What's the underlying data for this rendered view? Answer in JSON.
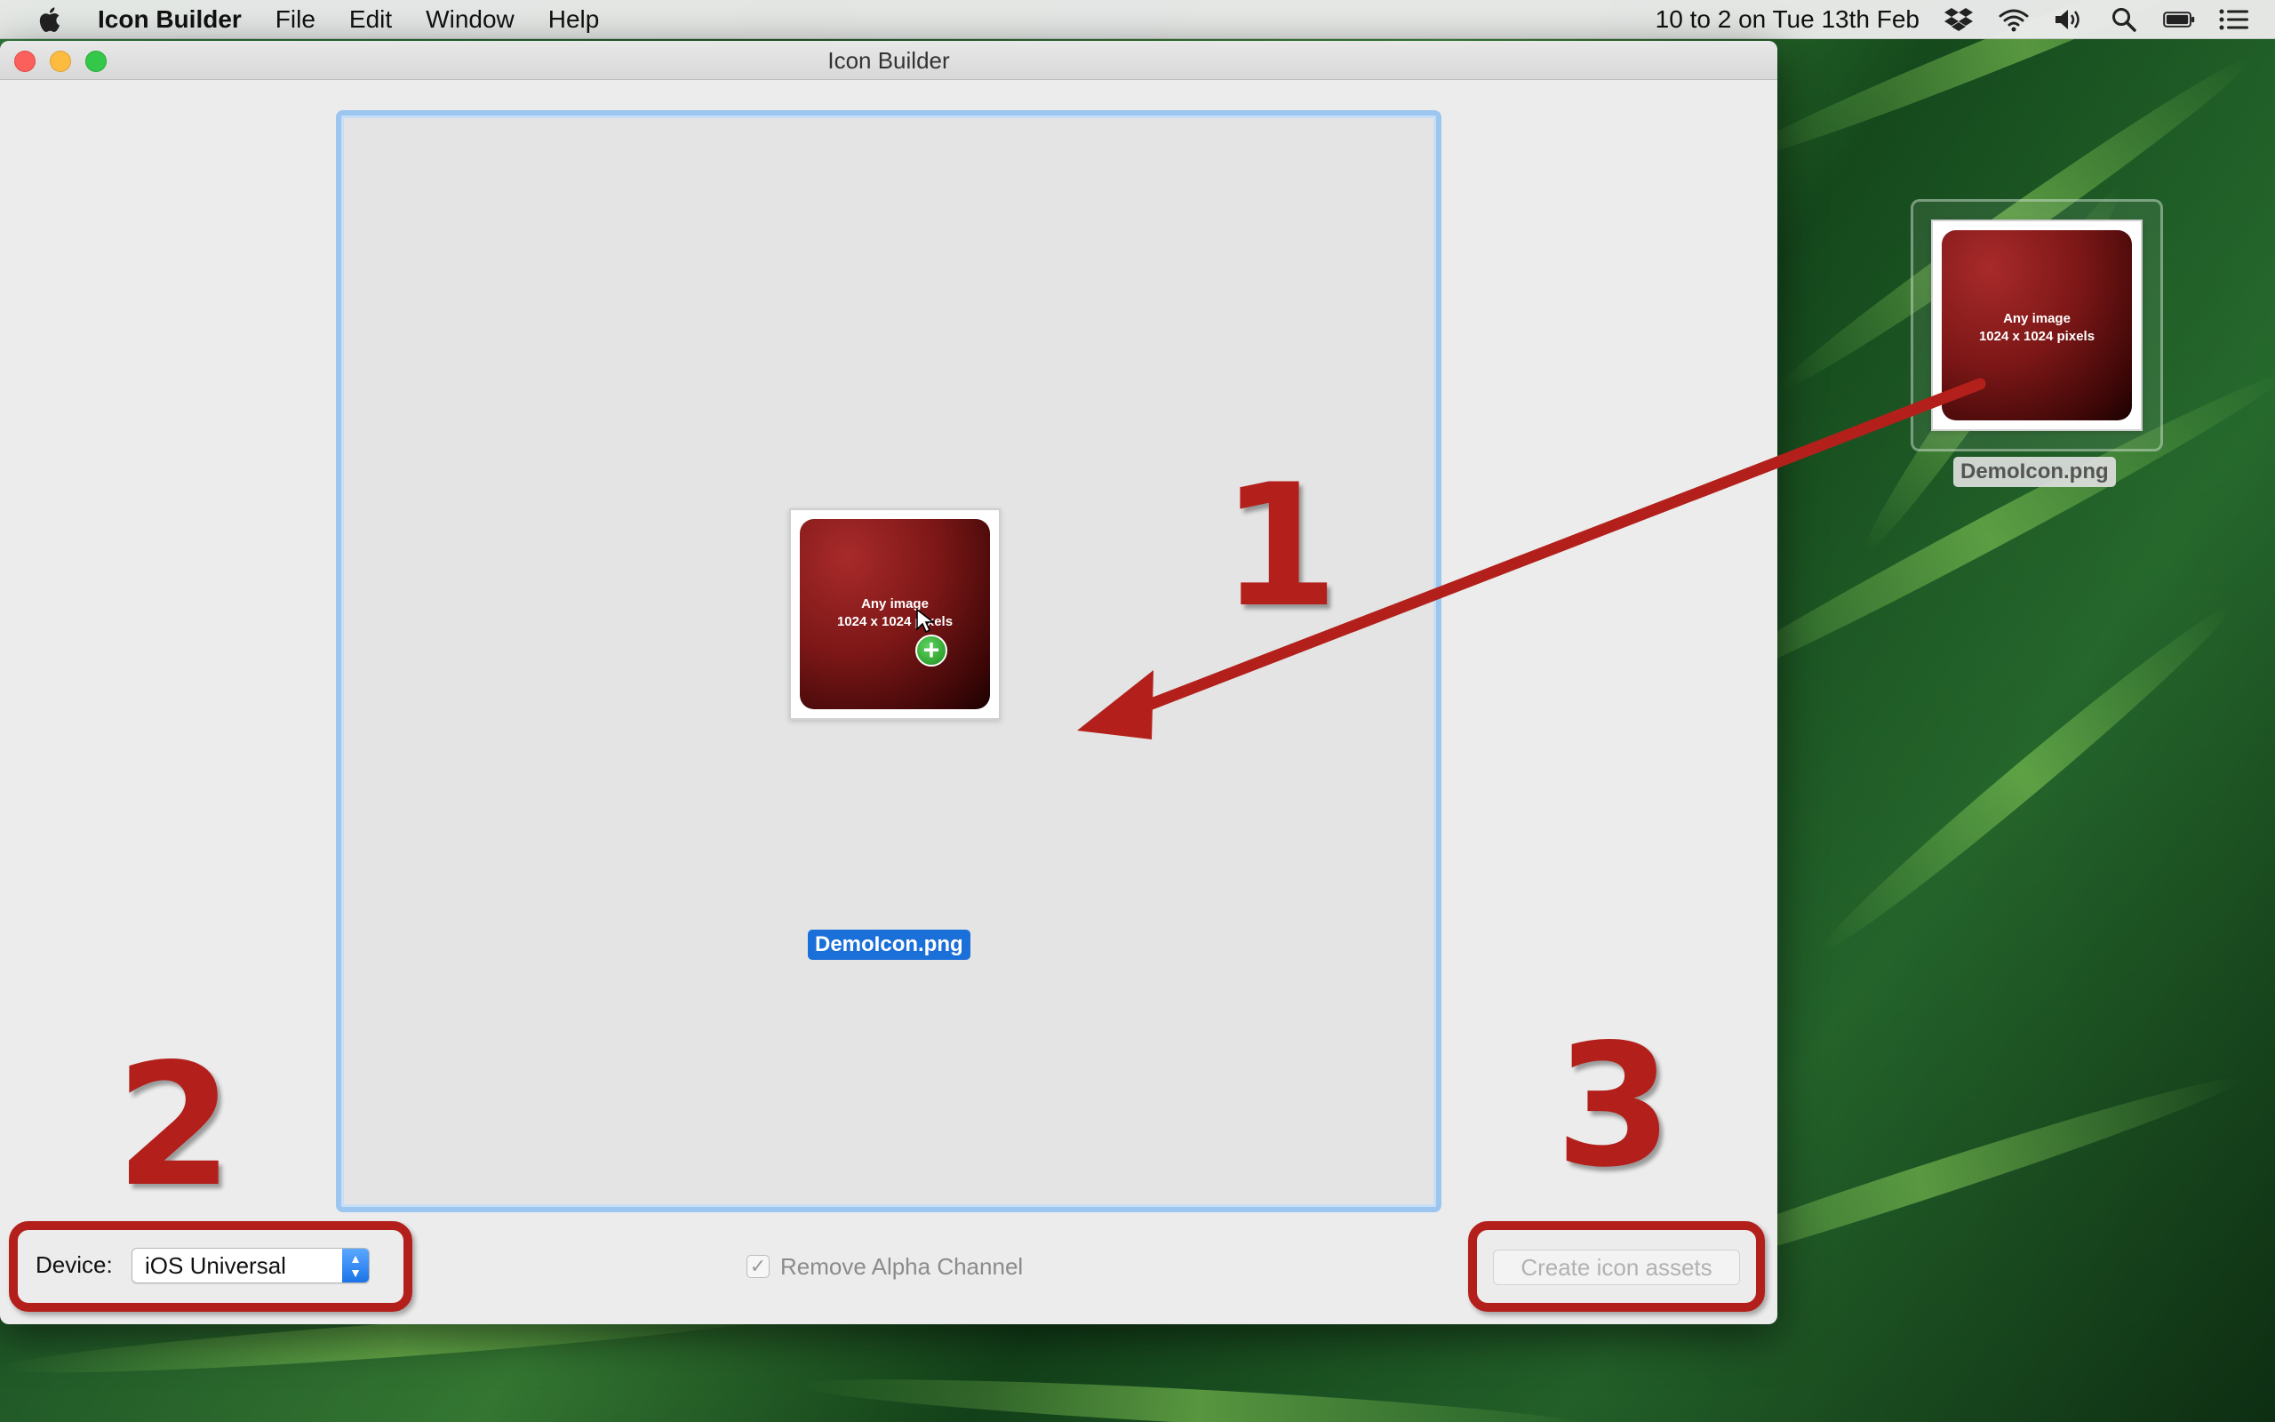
{
  "menubar": {
    "app_name": "Icon Builder",
    "menus": [
      "File",
      "Edit",
      "Window",
      "Help"
    ],
    "clock": "10 to 2 on Tue 13th Feb"
  },
  "window": {
    "title": "Icon Builder"
  },
  "dropzone": {
    "icon_text_line1": "Any image",
    "icon_text_line2": "1024 x 1024 pixels",
    "filename": "DemoIcon.png"
  },
  "controls": {
    "device_label": "Device:",
    "device_value": "iOS Universal",
    "remove_alpha_label": "Remove Alpha Channel",
    "remove_alpha_checked": true,
    "create_button": "Create icon assets",
    "create_button_enabled": false
  },
  "desktop_file": {
    "icon_text_line1": "Any image",
    "icon_text_line2": "1024 x 1024 pixels",
    "filename": "DemoIcon.png"
  },
  "annotations": {
    "step1": "1",
    "step2": "2",
    "step3": "3"
  },
  "colors": {
    "annotation_red": "#b3201b",
    "selection_blue": "#1b6fd8",
    "dropzone_border": "#9cc6ef"
  }
}
